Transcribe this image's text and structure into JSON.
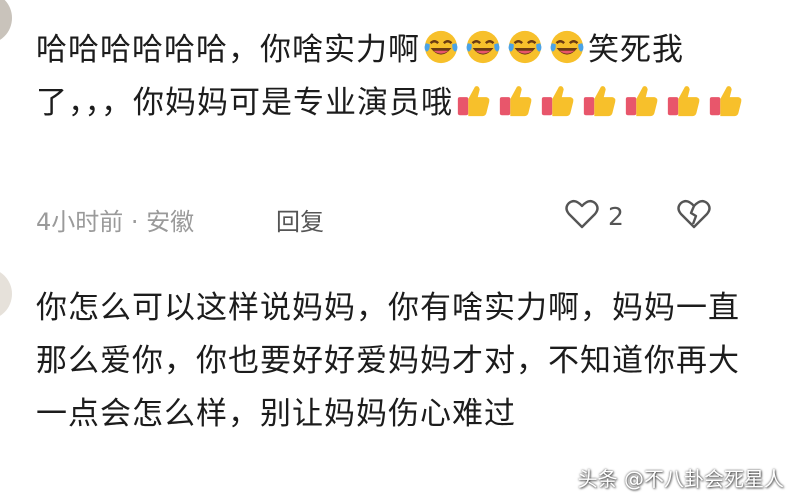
{
  "comments": [
    {
      "text_segments": {
        "a": "哈哈哈哈哈哈，你啥实力啊",
        "b": "笑死我了，，，你妈妈可是专业演员哦"
      },
      "emoji": {
        "laugh": "rolling-on-floor-laughing-icon",
        "thumbs": "thumbs-up-icon"
      },
      "time": "4小时前 · 安徽",
      "reply_label": "回复",
      "like_count": "2"
    },
    {
      "text": "你怎么可以这样说妈妈，你有啥实力啊，妈妈一直那么爱你，你也要好好爱妈妈才对，不知道你再大一点会怎么样，别让妈妈伤心难过"
    }
  ],
  "watermark": "头条 @不八卦会死星人",
  "colors": {
    "meta_gray": "#9a9a9a",
    "text": "#1c1c1c",
    "emoji_yellow": "#f7c02b",
    "sleeve_red": "#e8566b"
  }
}
